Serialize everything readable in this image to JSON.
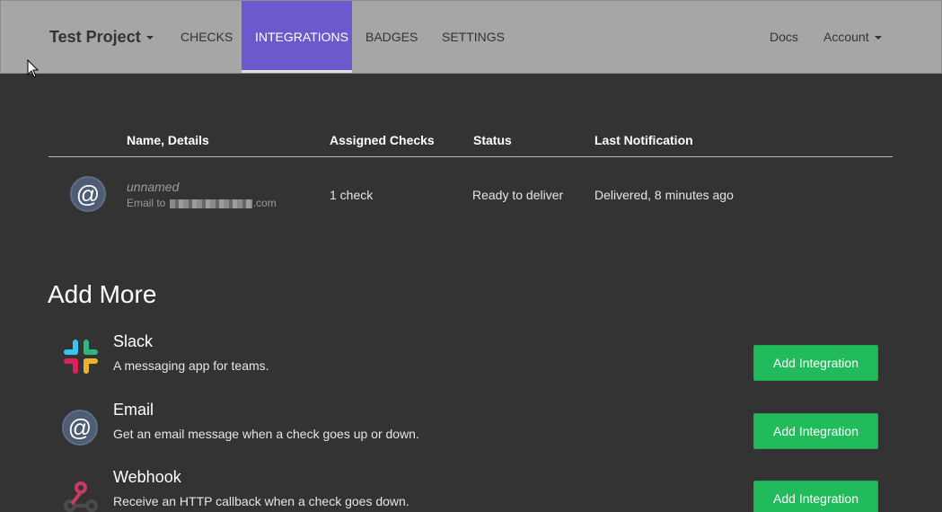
{
  "navbar": {
    "brand": "Test Project",
    "items": [
      {
        "label": "CHECKS"
      },
      {
        "label": "INTEGRATIONS"
      },
      {
        "label": "BADGES"
      },
      {
        "label": "SETTINGS"
      }
    ],
    "active_index": 1,
    "docs_label": "Docs",
    "account_label": "Account"
  },
  "table": {
    "headers": [
      "Name, Details",
      "Assigned Checks",
      "Status",
      "Last Notification"
    ],
    "rows": [
      {
        "icon": "email-at-icon",
        "name": "unnamed",
        "detail_prefix": "Email to",
        "detail_suffix": ".com",
        "assigned": "1 check",
        "status": "Ready to deliver",
        "last_notification": "Delivered, 8 minutes ago"
      }
    ]
  },
  "add_more": {
    "title": "Add More",
    "integrations": [
      {
        "name": "Slack",
        "icon": "slack-icon",
        "description": "A messaging app for teams.",
        "button_label": "Add Integration"
      },
      {
        "name": "Email",
        "icon": "email-at-icon",
        "description": "Get an email message when a check goes up or down.",
        "button_label": "Add Integration"
      },
      {
        "name": "Webhook",
        "icon": "webhook-icon",
        "description": "Receive an HTTP callback when a check goes down.",
        "button_label": "Add Integration"
      }
    ]
  },
  "colors": {
    "background": "#333333",
    "navbar": "#a6a6a6",
    "active_tab": "#6a5acd",
    "button": "#22bb5b"
  }
}
